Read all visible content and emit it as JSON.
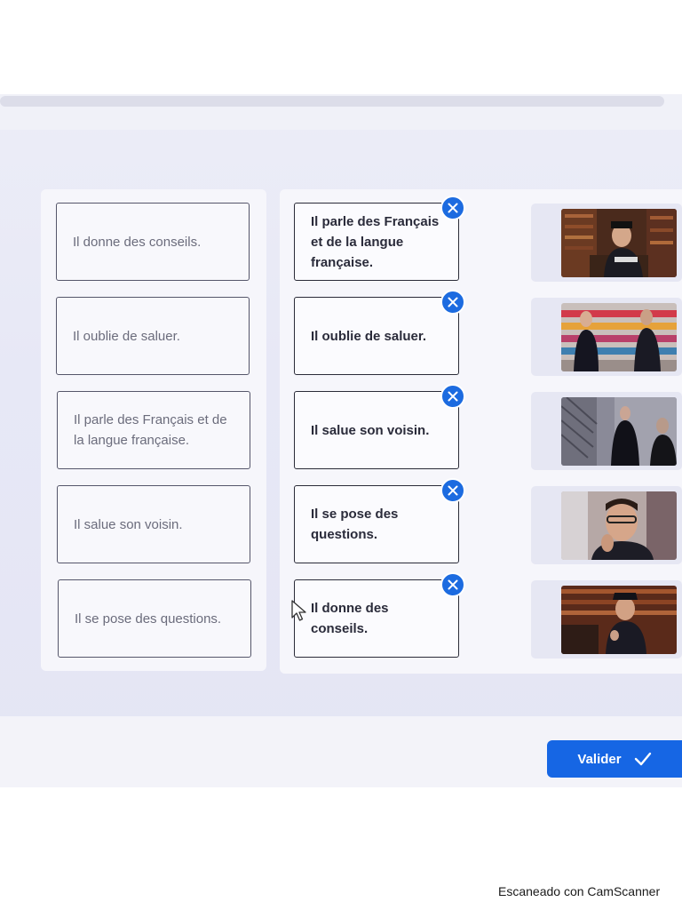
{
  "source_items": [
    {
      "text": "Il donne des conseils."
    },
    {
      "text": "Il oublie de saluer."
    },
    {
      "text": "Il parle des Français et de la langue française."
    },
    {
      "text": "Il salue son voisin."
    },
    {
      "text": "Il se pose des questions."
    }
  ],
  "matches": [
    {
      "text": "Il parle des Français et de la langue française.",
      "image": "man-reading-in-library-image"
    },
    {
      "text": "Il oublie de saluer.",
      "image": "two-people-in-shop-aisle-image"
    },
    {
      "text": "Il salue son voisin.",
      "image": "men-in-dark-stairwell-image"
    },
    {
      "text": "Il se pose des questions.",
      "image": "pensive-man-with-glasses-image"
    },
    {
      "text": "Il donne des conseils.",
      "image": "man-seated-in-library-image"
    }
  ],
  "actions": {
    "validate_label": "Valider"
  },
  "watermark": "Escaneado con CamScanner",
  "colors": {
    "accent": "#1666e4",
    "remove_button": "#1c6be0"
  }
}
